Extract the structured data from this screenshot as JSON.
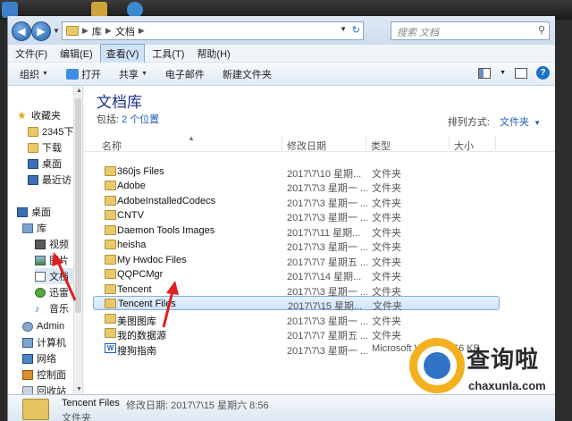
{
  "address": {
    "crumbs": [
      "库",
      "文档"
    ],
    "search_placeholder": "搜索 文档"
  },
  "menu": [
    "文件(F)",
    "编辑(E)",
    "查看(V)",
    "工具(T)",
    "帮助(H)"
  ],
  "toolbar": {
    "organize": "组织",
    "open": "打开",
    "share": "共享",
    "email": "电子邮件",
    "new_folder": "新建文件夹"
  },
  "sidebar": {
    "items": [
      {
        "label": "收藏夹"
      },
      {
        "label": "2345下"
      },
      {
        "label": "下载"
      },
      {
        "label": "桌面"
      },
      {
        "label": "最近访"
      },
      {
        "label": "桌面"
      },
      {
        "label": "库"
      },
      {
        "label": "视频"
      },
      {
        "label": "图片"
      },
      {
        "label": "文档"
      },
      {
        "label": "迅雷"
      },
      {
        "label": "音乐"
      },
      {
        "label": "Admin"
      },
      {
        "label": "计算机"
      },
      {
        "label": "网络"
      },
      {
        "label": "控制面"
      },
      {
        "label": "回收站"
      }
    ]
  },
  "library": {
    "title": "文档库",
    "includes_label": "包括:",
    "includes_link": "2 个位置",
    "arrange_label": "排列方式:",
    "arrange_value": "文件夹"
  },
  "columns": {
    "name": "名称",
    "date": "修改日期",
    "type": "类型",
    "size": "大小"
  },
  "files": [
    {
      "name": "360js Files",
      "date": "2017\\7\\10 星期...",
      "type": "文件夹",
      "size": ""
    },
    {
      "name": "Adobe",
      "date": "2017\\7\\3 星期一 ...",
      "type": "文件夹",
      "size": ""
    },
    {
      "name": "AdobeInstalledCodecs",
      "date": "2017\\7\\3 星期一 ...",
      "type": "文件夹",
      "size": ""
    },
    {
      "name": "CNTV",
      "date": "2017\\7\\3 星期一 ...",
      "type": "文件夹",
      "size": ""
    },
    {
      "name": "Daemon Tools Images",
      "date": "2017\\7\\11 星期...",
      "type": "文件夹",
      "size": ""
    },
    {
      "name": "heisha",
      "date": "2017\\7\\3 星期一 ...",
      "type": "文件夹",
      "size": ""
    },
    {
      "name": "My Hwdoc Files",
      "date": "2017\\7\\7 星期五 ...",
      "type": "文件夹",
      "size": ""
    },
    {
      "name": "QQPCMgr",
      "date": "2017\\7\\14 星期...",
      "type": "文件夹",
      "size": ""
    },
    {
      "name": "Tencent",
      "date": "2017\\7\\3 星期一 ...",
      "type": "文件夹",
      "size": ""
    },
    {
      "name": "Tencent Files",
      "date": "2017\\7\\15 星期...",
      "type": "文件夹",
      "size": ""
    },
    {
      "name": "美图图库",
      "date": "2017\\7\\3 星期一 ...",
      "type": "文件夹",
      "size": ""
    },
    {
      "name": "我的数据源",
      "date": "2017\\7\\7 星期五 ...",
      "type": "文件夹",
      "size": ""
    },
    {
      "name": "搜狗指南",
      "date": "2017\\7\\3 星期一 ...",
      "type": "Microsoft Word ...",
      "size": "66 KB"
    }
  ],
  "details": {
    "name": "Tencent Files",
    "meta": "修改日期: 2017\\7\\15 星期六 8:56",
    "type": "文件夹"
  },
  "watermark": {
    "text": "查询啦",
    "sub": "chaxunla.com"
  },
  "colors": {
    "accent": "#1f5fb8",
    "title": "#1e3287",
    "folder": "#e9c96a",
    "arrow": "#e02020"
  }
}
